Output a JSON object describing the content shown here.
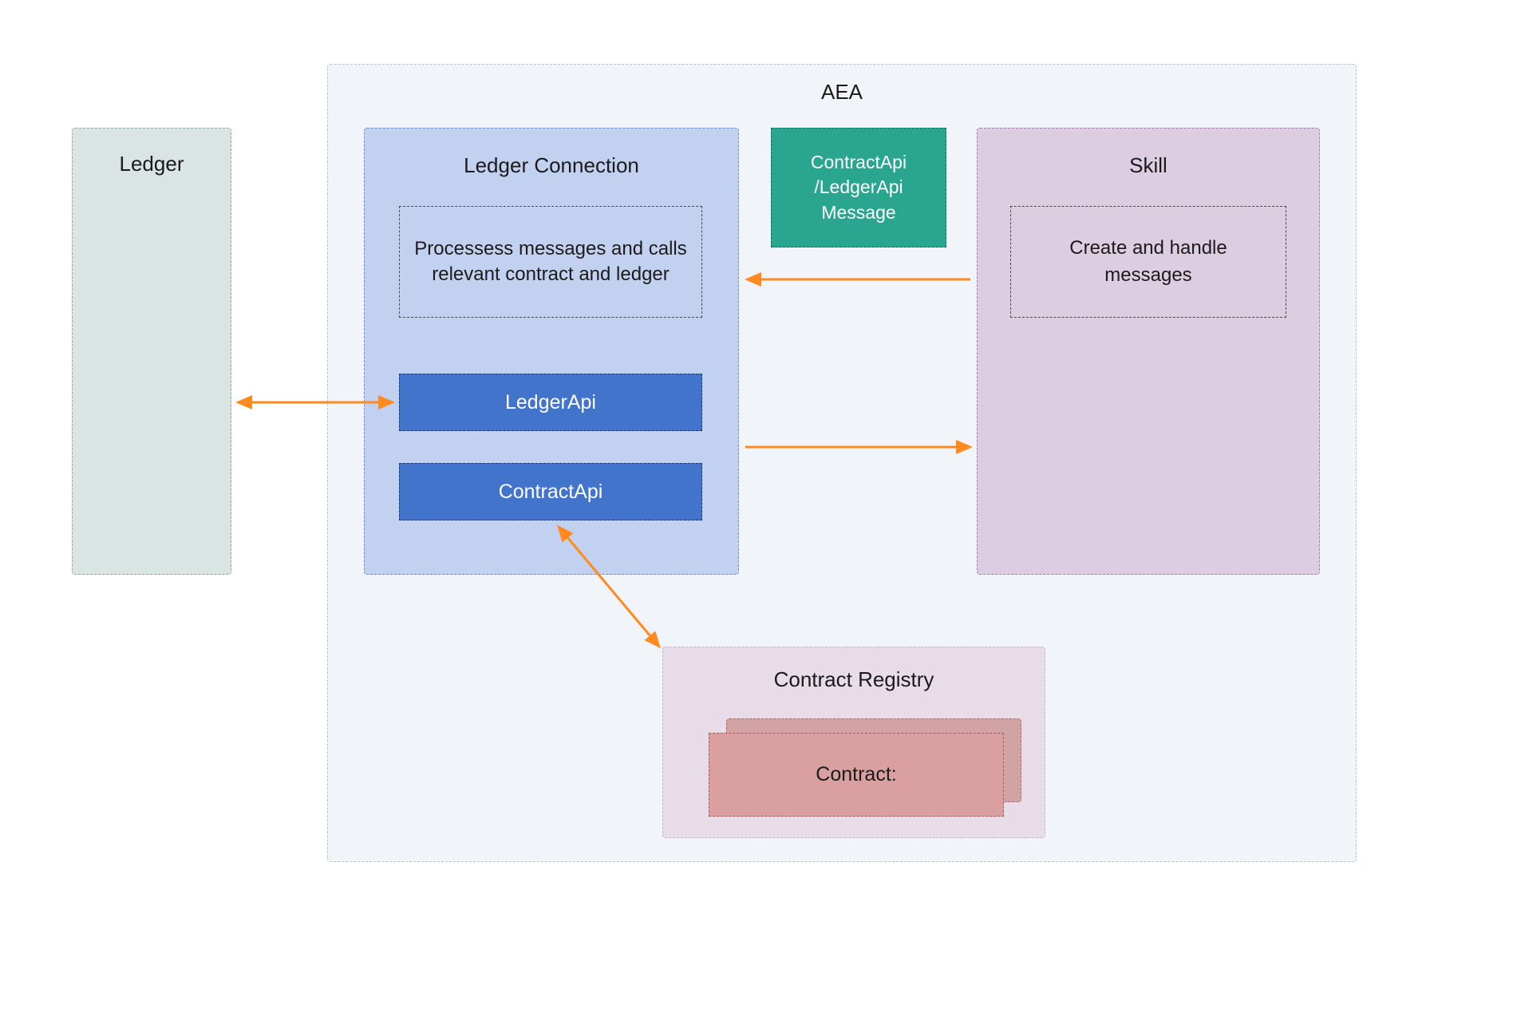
{
  "diagram": {
    "aea_title": "AEA",
    "ledger": {
      "title": "Ledger"
    },
    "ledger_connection": {
      "title": "Ledger Connection",
      "description": "Processess messages and calls relevant contract and ledger",
      "ledger_api_label": "LedgerApi",
      "contract_api_label": "ContractApi"
    },
    "message_box": "ContractApi /LedgerApi Message",
    "skill": {
      "title": "Skill",
      "description": "Create and handle messages"
    },
    "contract_registry": {
      "title": "Contract Registry",
      "contract_label": "Contract:"
    }
  },
  "colors": {
    "aea_bg": "#f1f4f8",
    "ledger_bg": "#d9e4e3",
    "ledger_conn_bg": "#c2d1ef",
    "api_bg": "#4274cc",
    "message_bg": "#2aa590",
    "skill_bg": "#dccde0",
    "registry_bg": "#e7dce8",
    "contract_bg": "#da9f9f",
    "arrow": "#ff8a1f"
  }
}
